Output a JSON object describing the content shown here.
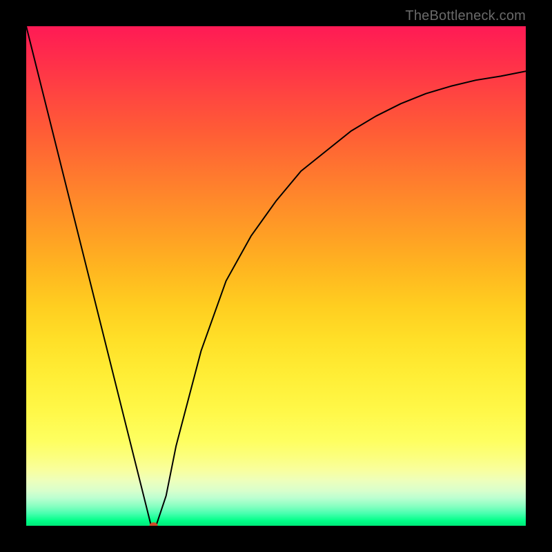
{
  "attribution": "TheBottleneck.com",
  "colors": {
    "background": "#000000",
    "gradient_top": "#ff1a55",
    "gradient_bottom": "#00e878",
    "curve": "#000000",
    "marker": "#d04a2a"
  },
  "chart_data": {
    "type": "line",
    "title": "",
    "xlabel": "",
    "ylabel": "",
    "xlim": [
      0,
      100
    ],
    "ylim": [
      0,
      100
    ],
    "series": [
      {
        "name": "bottleneck-curve",
        "x": [
          0,
          5,
          10,
          15,
          20,
          22,
          24,
          25,
          26,
          28,
          30,
          35,
          40,
          45,
          50,
          55,
          60,
          65,
          70,
          75,
          80,
          85,
          90,
          95,
          100
        ],
        "values": [
          100,
          80,
          60,
          40,
          20,
          12,
          4,
          0,
          0,
          6,
          16,
          35,
          49,
          58,
          65,
          71,
          75,
          79,
          82,
          84.5,
          86.5,
          88,
          89.2,
          90,
          91
        ]
      }
    ],
    "marker": {
      "x": 25.5,
      "y": 0
    },
    "background_gradient": {
      "type": "vertical",
      "stops": [
        {
          "pos": 0,
          "color": "#ff1a55"
        },
        {
          "pos": 50,
          "color": "#ffb720"
        },
        {
          "pos": 80,
          "color": "#feff60"
        },
        {
          "pos": 100,
          "color": "#00e878"
        }
      ]
    }
  }
}
